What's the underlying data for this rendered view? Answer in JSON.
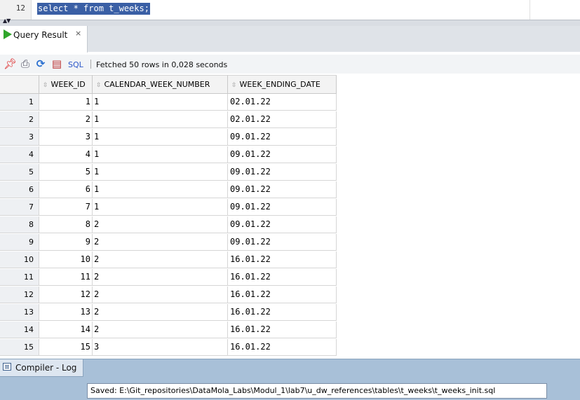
{
  "editor": {
    "line_number": "12",
    "code": "select * from t_weeks;"
  },
  "result_tab": {
    "label": "Query Result",
    "close_glyph": "×"
  },
  "toolbar": {
    "icons": [
      "pin-icon",
      "print-icon",
      "refresh-icon",
      "sql-file-icon"
    ],
    "sql_link": "SQL",
    "separator": "|",
    "fetched_text": "Fetched 50 rows in 0,028 seconds"
  },
  "grid": {
    "columns": [
      "WEEK_ID",
      "CALENDAR_WEEK_NUMBER",
      "WEEK_ENDING_DATE"
    ],
    "rows": [
      [
        "1",
        "1",
        "1",
        "02.01.22"
      ],
      [
        "2",
        "2",
        "1",
        "02.01.22"
      ],
      [
        "3",
        "3",
        "1",
        "09.01.22"
      ],
      [
        "4",
        "4",
        "1",
        "09.01.22"
      ],
      [
        "5",
        "5",
        "1",
        "09.01.22"
      ],
      [
        "6",
        "6",
        "1",
        "09.01.22"
      ],
      [
        "7",
        "7",
        "1",
        "09.01.22"
      ],
      [
        "8",
        "8",
        "2",
        "09.01.22"
      ],
      [
        "9",
        "9",
        "2",
        "09.01.22"
      ],
      [
        "10",
        "10",
        "2",
        "16.01.22"
      ],
      [
        "11",
        "11",
        "2",
        "16.01.22"
      ],
      [
        "12",
        "12",
        "2",
        "16.01.22"
      ],
      [
        "13",
        "13",
        "2",
        "16.01.22"
      ],
      [
        "14",
        "14",
        "2",
        "16.01.22"
      ],
      [
        "15",
        "15",
        "3",
        "16.01.22"
      ]
    ]
  },
  "bottom_panel": {
    "log_tab_label": "Compiler - Log",
    "status": "Saved: E:\\Git_repositories\\DataMola_Labs\\Modul_1\\lab7\\u_dw_references\\tables\\t_weeks\\t_weeks_init.sql"
  },
  "colors": {
    "selection": "#3a5fa5",
    "run_icon": "#2fa52a",
    "panel": "#a8c0d8"
  }
}
